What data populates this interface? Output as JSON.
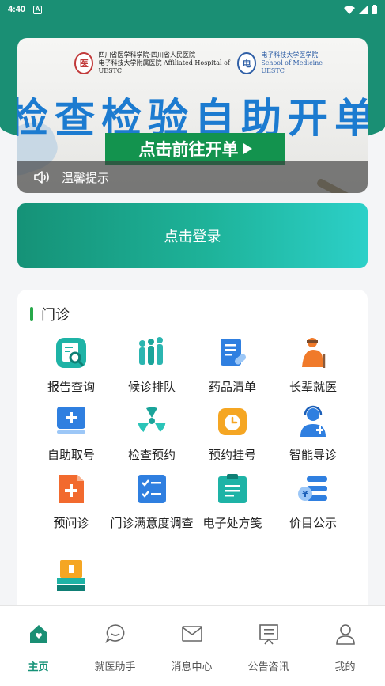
{
  "status_bar": {
    "time": "4:40",
    "badge": "A"
  },
  "banner": {
    "hospital_name_1": "四川省医学科学院·四川省人民医院",
    "hospital_name_2": "电子科技大学附属医院",
    "hospital_name_en": "Affiliated Hospital of UESTC",
    "school_name": "电子科技大学医学院",
    "school_name_en": "School of Medicine UESTC",
    "headline": "检查检验自助开单",
    "cta": "点击前往开单",
    "notice": "温馨提示"
  },
  "login": {
    "label": "点击登录"
  },
  "outpatient": {
    "title": "门诊",
    "items": [
      {
        "label": "报告查询",
        "icon": "report-search-icon"
      },
      {
        "label": "候诊排队",
        "icon": "queue-icon"
      },
      {
        "label": "药品清单",
        "icon": "medicine-list-icon"
      },
      {
        "label": "长辈就医",
        "icon": "elder-care-icon"
      },
      {
        "label": "自助取号",
        "icon": "self-ticket-icon"
      },
      {
        "label": "检查预约",
        "icon": "radiation-icon"
      },
      {
        "label": "预约挂号",
        "icon": "alarm-clock-icon"
      },
      {
        "label": "智能导诊",
        "icon": "headset-doctor-icon"
      },
      {
        "label": "预问诊",
        "icon": "pre-consult-icon"
      },
      {
        "label": "门诊满意度调查",
        "icon": "survey-checklist-icon"
      },
      {
        "label": "电子处方笺",
        "icon": "e-prescription-icon"
      },
      {
        "label": "价目公示",
        "icon": "price-list-icon"
      },
      {
        "label": "",
        "icon": "payment-machine-icon"
      }
    ]
  },
  "tabbar": {
    "items": [
      {
        "label": "主页",
        "icon": "home-icon",
        "active": true
      },
      {
        "label": "就医助手",
        "icon": "chat-bubble-icon",
        "active": false
      },
      {
        "label": "消息中心",
        "icon": "mail-icon",
        "active": false
      },
      {
        "label": "公告咨讯",
        "icon": "board-icon",
        "active": false
      },
      {
        "label": "我的",
        "icon": "user-icon",
        "active": false
      }
    ]
  },
  "colors": {
    "brand": "#1a8f74",
    "accent_green": "#27a84a",
    "headline_blue": "#1c7bd0"
  }
}
